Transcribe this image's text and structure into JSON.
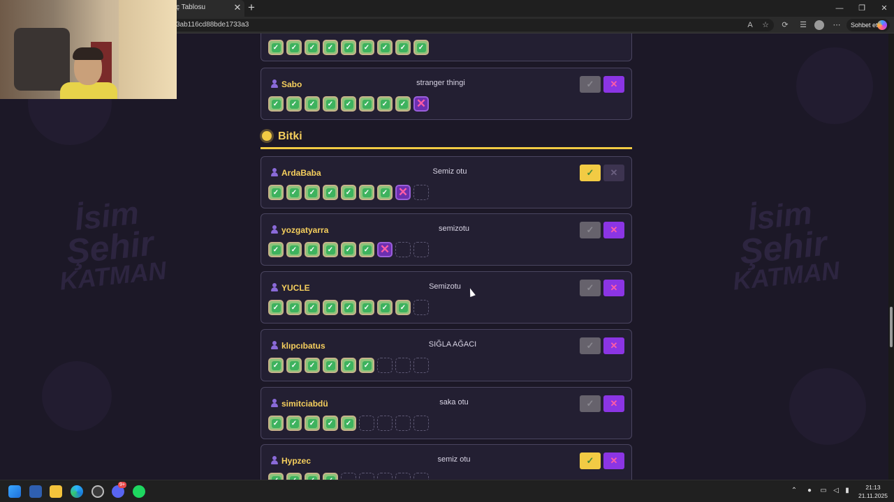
{
  "browser": {
    "tab_title": "ç Tablosu",
    "tab_close": "✕",
    "new_tab": "+",
    "url": "3ab116cd88bde1733a3",
    "chat_label": "Sohbet et",
    "window_controls": [
      "—",
      "❐",
      "✕"
    ]
  },
  "background_logo": {
    "line1": "İsim",
    "line2": "Şehir",
    "line3": "KATMAN"
  },
  "top_card": {
    "boxes": [
      "ok",
      "ok",
      "ok",
      "ok",
      "ok",
      "ok",
      "ok",
      "ok",
      "ok"
    ]
  },
  "cards_before_section": [
    {
      "player": "Sabo",
      "answer": "stranger thingi",
      "approve": "grey",
      "reject": "purple",
      "boxes": [
        "ok",
        "ok",
        "ok",
        "ok",
        "ok",
        "ok",
        "ok",
        "ok",
        "fail"
      ]
    }
  ],
  "section": {
    "title": "Bitki",
    "icon": "sun-icon"
  },
  "cards": [
    {
      "player": "ArdaBaba",
      "answer": "Semiz otu",
      "approve": "yellow",
      "reject": "dim",
      "boxes": [
        "ok",
        "ok",
        "ok",
        "ok",
        "ok",
        "ok",
        "ok",
        "fail",
        "empty"
      ]
    },
    {
      "player": "yozgatyarra",
      "answer": "semizotu",
      "approve": "grey",
      "reject": "purple",
      "boxes": [
        "ok",
        "ok",
        "ok",
        "ok",
        "ok",
        "ok",
        "fail",
        "empty",
        "empty"
      ]
    },
    {
      "player": "YUCLE",
      "answer": "Semizotu",
      "approve": "grey",
      "reject": "purple",
      "boxes": [
        "ok",
        "ok",
        "ok",
        "ok",
        "ok",
        "ok",
        "ok",
        "ok",
        "empty"
      ]
    },
    {
      "player": "klıpcıbatus",
      "answer": "SIĞLA AĞACI",
      "approve": "grey",
      "reject": "purple",
      "boxes": [
        "ok",
        "ok",
        "ok",
        "ok",
        "ok",
        "ok",
        "empty",
        "empty",
        "empty"
      ]
    },
    {
      "player": "simitciabdü",
      "answer": "saka otu",
      "approve": "grey",
      "reject": "purple",
      "boxes": [
        "ok",
        "ok",
        "ok",
        "ok",
        "ok",
        "empty",
        "empty",
        "empty",
        "empty"
      ]
    },
    {
      "player": "Hypzec",
      "answer": "semiz otu",
      "approve": "yellow",
      "reject": "purple",
      "boxes": [
        "ok",
        "ok",
        "ok",
        "ok",
        "empty",
        "empty",
        "empty",
        "empty",
        "empty"
      ]
    }
  ],
  "colors": {
    "accent": "#f2cb44",
    "reject": "#8b35e4",
    "ok": "#3eb25e",
    "background": "#1c1827"
  },
  "taskbar": {
    "apps": [
      "start-icon",
      "store-icon",
      "file-explorer-icon",
      "edge-icon",
      "clock-app-icon",
      "discord-icon",
      "spotify-icon"
    ],
    "discord_badge": "9+",
    "time": "21:13",
    "date": "21.11.2025"
  }
}
